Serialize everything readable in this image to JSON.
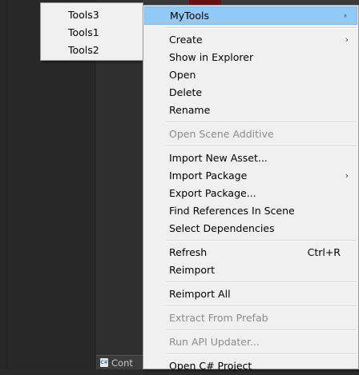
{
  "background": {
    "bottom_tab_label": "Cont",
    "bottom_tab_icon": "csharp-file-icon"
  },
  "submenu": {
    "items": [
      {
        "label": "Tools3"
      },
      {
        "label": "Tools1"
      },
      {
        "label": "Tools2"
      }
    ]
  },
  "context_menu": {
    "mytools": "MyTools",
    "create": "Create",
    "show_in_explorer": "Show in Explorer",
    "open": "Open",
    "delete": "Delete",
    "rename": "Rename",
    "open_scene_additive": "Open Scene Additive",
    "import_new_asset": "Import New Asset...",
    "import_package": "Import Package",
    "export_package": "Export Package...",
    "find_references": "Find References In Scene",
    "select_dependencies": "Select Dependencies",
    "refresh": "Refresh",
    "refresh_shortcut": "Ctrl+R",
    "reimport": "Reimport",
    "reimport_all": "Reimport All",
    "extract_from_prefab": "Extract From Prefab",
    "run_api_updater": "Run API Updater...",
    "open_csharp_project": "Open C# Project",
    "submenu_arrow": "›"
  },
  "colors": {
    "highlight": "#91c9f7",
    "menu_bg": "#f0f0f0",
    "disabled_text": "#8c8c8c"
  }
}
